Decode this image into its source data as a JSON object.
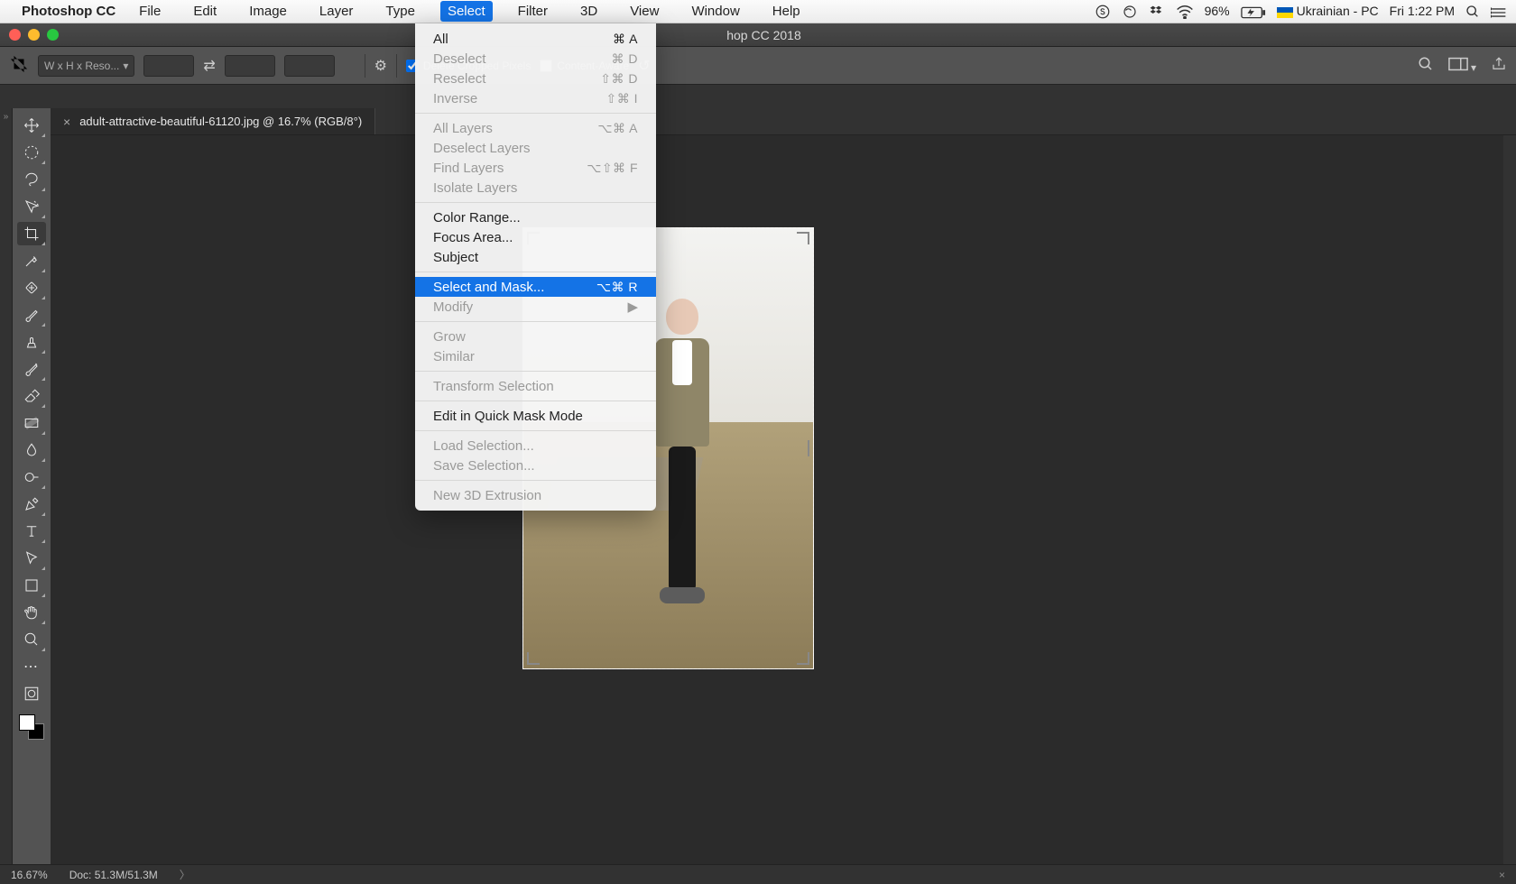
{
  "menubar": {
    "app": "Photoshop CC",
    "items": [
      {
        "label": "File"
      },
      {
        "label": "Edit"
      },
      {
        "label": "Image"
      },
      {
        "label": "Layer"
      },
      {
        "label": "Type"
      },
      {
        "label": "Select",
        "active": true
      },
      {
        "label": "Filter"
      },
      {
        "label": "3D"
      },
      {
        "label": "View"
      },
      {
        "label": "Window"
      },
      {
        "label": "Help"
      }
    ],
    "tray": {
      "battery": "96%",
      "input": "Ukrainian - PC",
      "clock": "Fri 1:22 PM"
    }
  },
  "window": {
    "title": "hop CC 2018"
  },
  "options": {
    "ratio_preset": "W x H x Reso...",
    "delete_label": "Delete Cropped Pixels",
    "content_aware_label": "Content-Aware"
  },
  "document": {
    "tab_title": "adult-attractive-beautiful-61120.jpg @ 16.7% (RGB/8°)"
  },
  "menu": {
    "all": {
      "label": "All",
      "shortcut": "⌘ A",
      "disabled": false
    },
    "deselect": {
      "label": "Deselect",
      "shortcut": "⌘ D",
      "disabled": true
    },
    "reselect": {
      "label": "Reselect",
      "shortcut": "⇧⌘ D",
      "disabled": true
    },
    "inverse": {
      "label": "Inverse",
      "shortcut": "⇧⌘ I",
      "disabled": true
    },
    "all_layers": {
      "label": "All Layers",
      "shortcut": "⌥⌘ A",
      "disabled": true
    },
    "deselect_layers": {
      "label": "Deselect Layers",
      "shortcut": "",
      "disabled": true
    },
    "find_layers": {
      "label": "Find Layers",
      "shortcut": "⌥⇧⌘ F",
      "disabled": true
    },
    "isolate_layers": {
      "label": "Isolate Layers",
      "shortcut": "",
      "disabled": true
    },
    "color_range": {
      "label": "Color Range...",
      "shortcut": "",
      "disabled": false
    },
    "focus_area": {
      "label": "Focus Area...",
      "shortcut": "",
      "disabled": false
    },
    "subject": {
      "label": "Subject",
      "shortcut": "",
      "disabled": false
    },
    "select_mask": {
      "label": "Select and Mask...",
      "shortcut": "⌥⌘ R",
      "disabled": false,
      "hover": true
    },
    "modify": {
      "label": "Modify",
      "submenu": true,
      "disabled": true
    },
    "grow": {
      "label": "Grow",
      "shortcut": "",
      "disabled": true
    },
    "similar": {
      "label": "Similar",
      "shortcut": "",
      "disabled": true
    },
    "transform_sel": {
      "label": "Transform Selection",
      "shortcut": "",
      "disabled": true
    },
    "quick_mask": {
      "label": "Edit in Quick Mask Mode",
      "shortcut": "",
      "disabled": false
    },
    "load_sel": {
      "label": "Load Selection...",
      "shortcut": "",
      "disabled": true
    },
    "save_sel": {
      "label": "Save Selection...",
      "shortcut": "",
      "disabled": true
    },
    "new_3d": {
      "label": "New 3D Extrusion",
      "shortcut": "",
      "disabled": true
    }
  },
  "status": {
    "zoom": "16.67%",
    "doc": "Doc: 51.3M/51.3M"
  }
}
